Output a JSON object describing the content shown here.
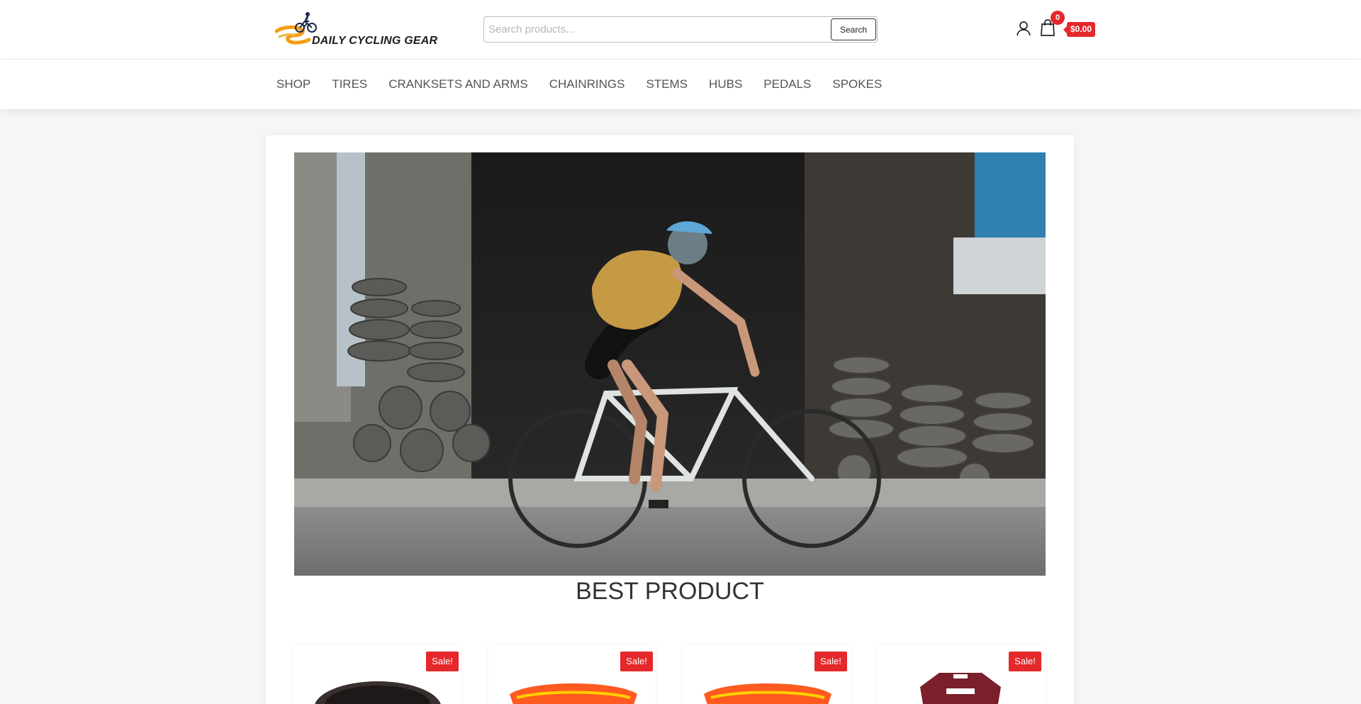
{
  "header": {
    "logo_text": "DAILY CYCLING GEAR",
    "search_placeholder": "Search products...",
    "search_button": "Search",
    "cart_count": "0",
    "cart_total": "$0.00"
  },
  "nav": {
    "items": [
      "SHOP",
      "TIRES",
      "CRANKSETS AND ARMS",
      "CHAINRINGS",
      "STEMS",
      "HUBS",
      "PEDALS",
      "SPOKES"
    ]
  },
  "main": {
    "section_title": "BEST PRODUCT",
    "products": [
      {
        "badge": "Sale!"
      },
      {
        "badge": "Sale!"
      },
      {
        "badge": "Sale!"
      },
      {
        "badge": "Sale!"
      }
    ]
  },
  "colors": {
    "accent": "#e4282b",
    "logo_orange": "#f39c12",
    "text": "#555555"
  }
}
